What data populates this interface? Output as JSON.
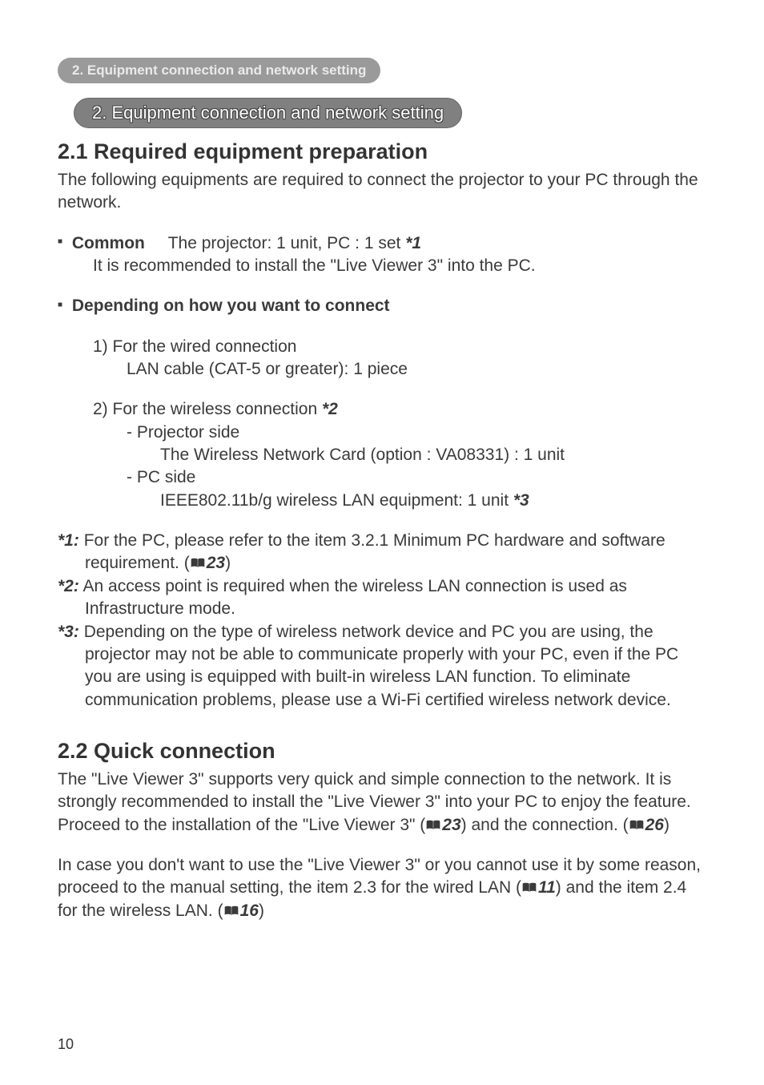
{
  "crumb": "2. Equipment connection and network setting",
  "chapter_title": "2. Equipment connection and network setting",
  "section_21": {
    "title": "2.1 Required equipment preparation",
    "intro": "The following equipments are required to connect the projector to your PC through the network.",
    "common_label": "Common",
    "common_text": "The projector: 1 unit,    PC : 1 set ",
    "common_star": "*1",
    "common_note": "It is recommended to install the \"Live Viewer 3\" into the PC.",
    "depending_label": "Depending on how you want to connect",
    "item1_header": "1) For the wired connection",
    "item1_body": "LAN cable (CAT-5 or greater): 1 piece",
    "item2_header_pre": "2) For the wireless connection ",
    "item2_header_star": "*2",
    "item2_side_proj": "- Projector side",
    "item2_proj_body": "The Wireless Network Card (option : VA08331) : 1 unit",
    "item2_side_pc": "- PC side",
    "item2_pc_body_pre": "IEEE802.11b/g wireless LAN equipment: 1 unit ",
    "item2_pc_body_star": "*3",
    "note1_star": "*1:",
    "note1_text_pre": " For the PC, please refer to the item 3.2.1 Minimum PC hardware and software requirement. (",
    "note1_ref": "23",
    "note1_text_post": ")",
    "note2_star": "*2:",
    "note2_text": " An access point is required when the wireless LAN connection is used as Infrastructure mode.",
    "note3_star": "*3:",
    "note3_text": " Depending on the type of wireless network device and PC you are using, the projector may not be able to communicate properly with your PC, even if the PC you are using is equipped with built-in wireless LAN function. To eliminate communication problems, please use a Wi-Fi certified wireless network device."
  },
  "section_22": {
    "title": "2.2 Quick connection",
    "para1_pre": "The \"Live Viewer 3\" supports very quick and simple connection to the network. It is strongly recommended to install the \"Live Viewer 3\" into your PC to enjoy the feature. Proceed to the installation of the \"Live Viewer 3\" (",
    "ref1": "23",
    "para1_mid": ") and the connection. (",
    "ref2": "26",
    "para1_post": ")",
    "para2_pre": "In case you don't want to use the \"Live Viewer 3\" or you cannot use it by some reason, proceed to the manual setting, the item 2.3 for the wired LAN (",
    "ref3": "11",
    "para2_mid": ") and the item 2.4 for the wireless LAN. (",
    "ref4": "16",
    "para2_post": ")"
  },
  "page_number": "10"
}
